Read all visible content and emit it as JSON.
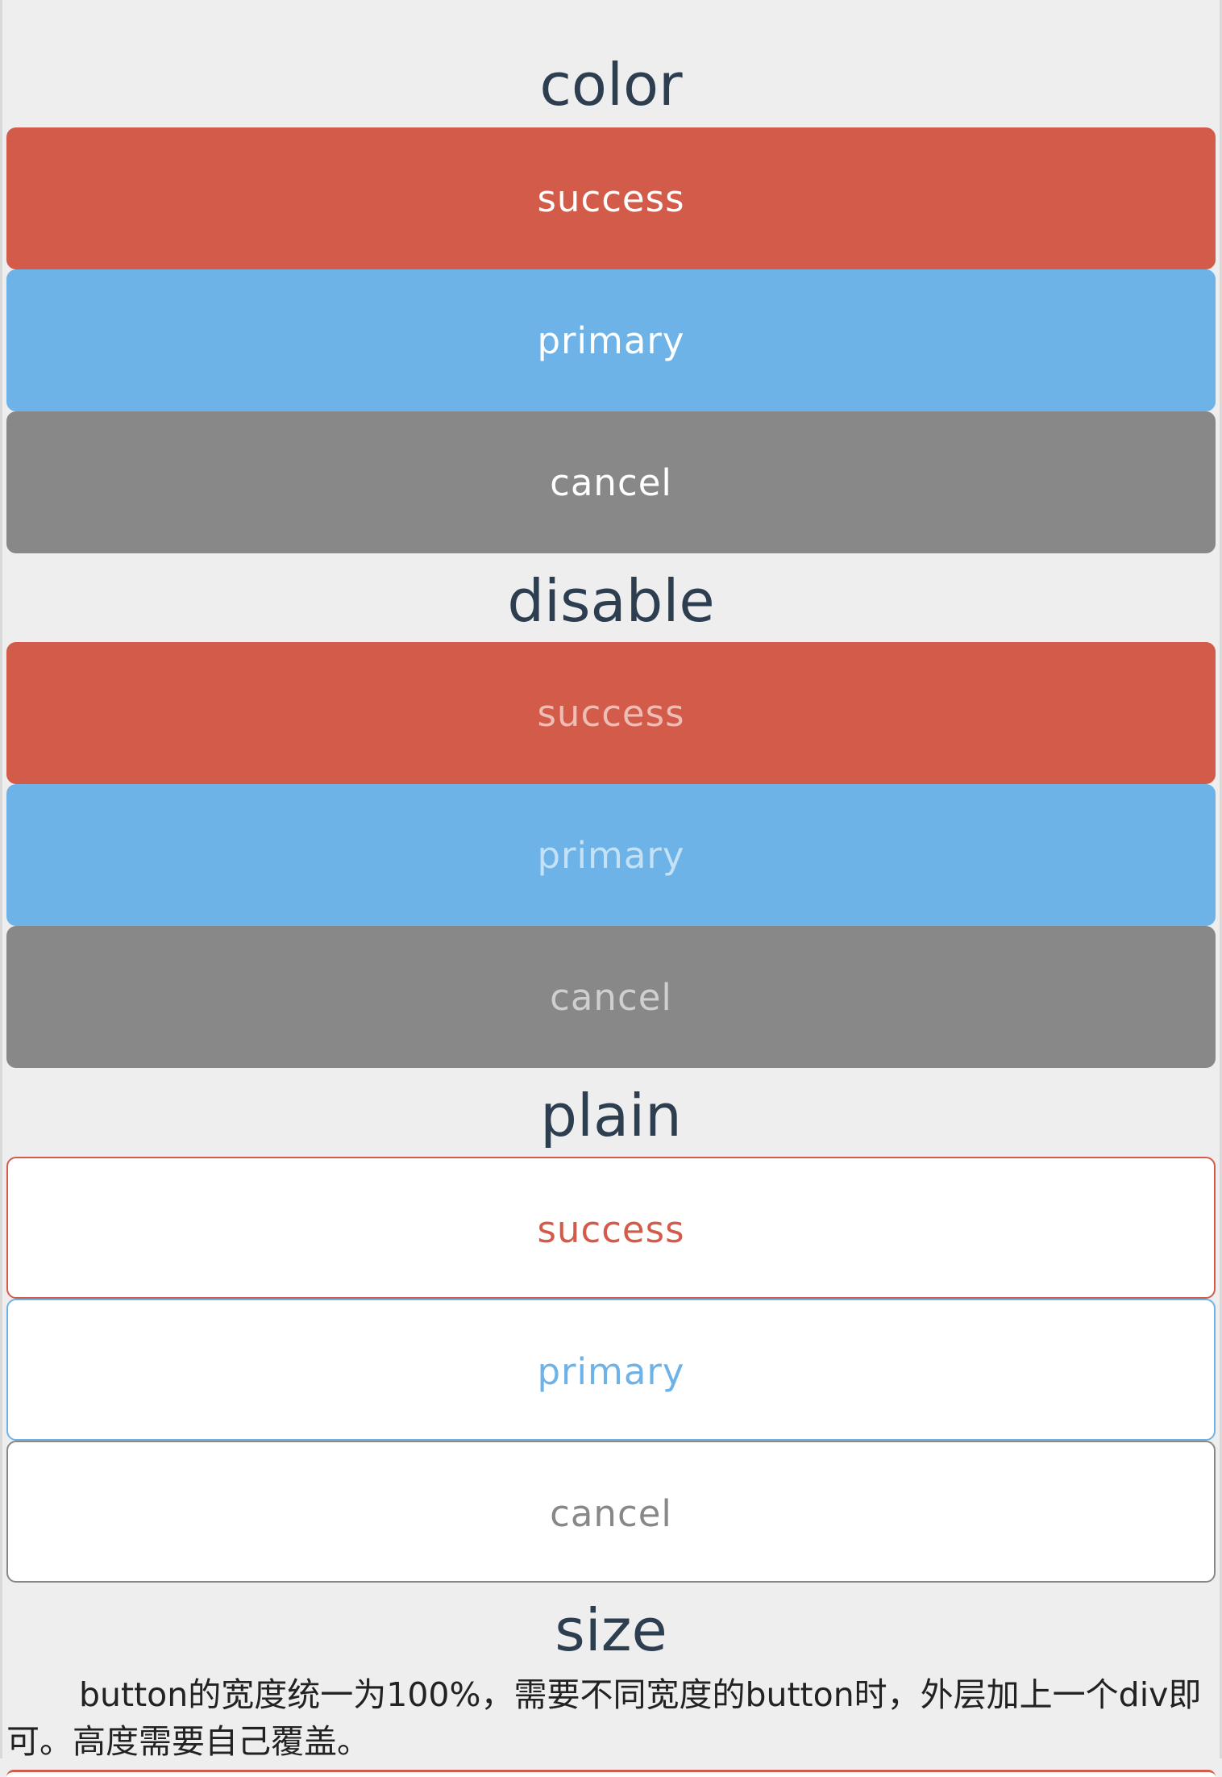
{
  "sections": {
    "color": {
      "title": "color",
      "buttons": [
        "success",
        "primary",
        "cancel"
      ]
    },
    "disable": {
      "title": "disable",
      "buttons": [
        "success",
        "primary",
        "cancel"
      ]
    },
    "plain": {
      "title": "plain",
      "buttons": [
        "success",
        "primary",
        "cancel"
      ]
    },
    "size": {
      "title": "size",
      "description": "button的宽度统一为100%，需要不同宽度的button时，外层加上一个div即可。高度需要自己覆盖。"
    }
  },
  "colors": {
    "success": "#d35b4a",
    "primary": "#6db3e8",
    "cancel": "#888888",
    "title": "#2c3e50",
    "background": "#eeeeee"
  }
}
